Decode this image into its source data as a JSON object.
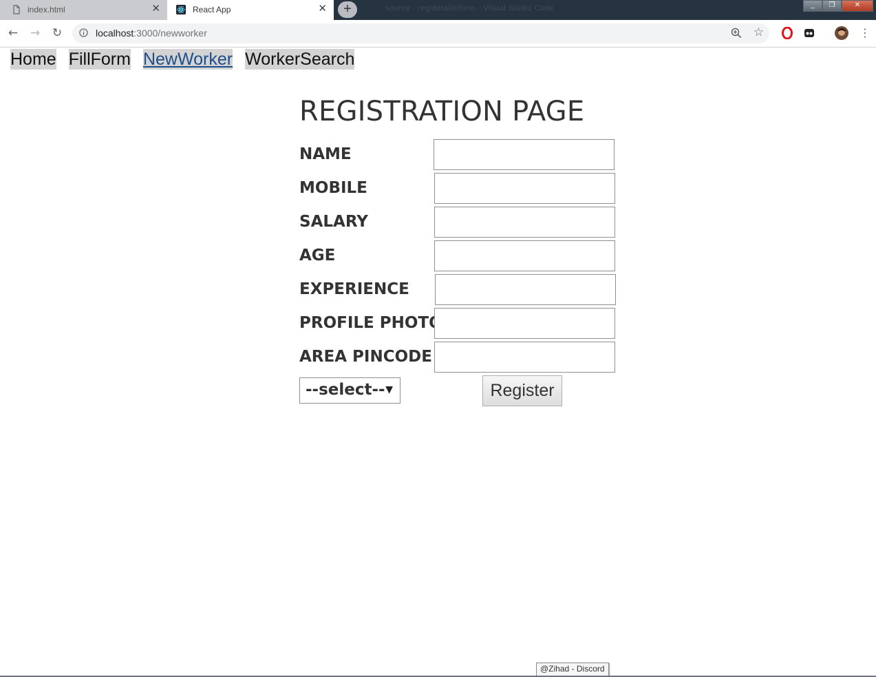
{
  "browser": {
    "tabs": [
      {
        "title": "index.html",
        "icon": "document-icon"
      },
      {
        "title": "React App",
        "icon": "react-icon"
      }
    ],
    "new_tab_label": "+",
    "background_window_title": "source · reg/details/form · Visual Studio Code",
    "url_host": "localhost",
    "url_path": ":3000/newworker",
    "window_controls": [
      "_",
      "❐",
      "✕"
    ]
  },
  "nav": {
    "links": [
      "Home",
      "FillForm",
      "NewWorker",
      "WorkerSearch"
    ],
    "active": "NewWorker"
  },
  "form": {
    "heading": "REGISTRATION PAGE",
    "fields": [
      {
        "label": "NAME",
        "value": ""
      },
      {
        "label": "MOBILE",
        "value": ""
      },
      {
        "label": "SALARY",
        "value": ""
      },
      {
        "label": "AGE",
        "value": ""
      },
      {
        "label": "EXPERIENCE",
        "value": ""
      },
      {
        "label": "PROFILE PHOTO",
        "value": ""
      },
      {
        "label": "AREA PINCODE",
        "value": ""
      }
    ],
    "select_value": "--select--",
    "register_label": "Register"
  },
  "taskbar": {
    "tooltip": "@Zihad - Discord"
  }
}
